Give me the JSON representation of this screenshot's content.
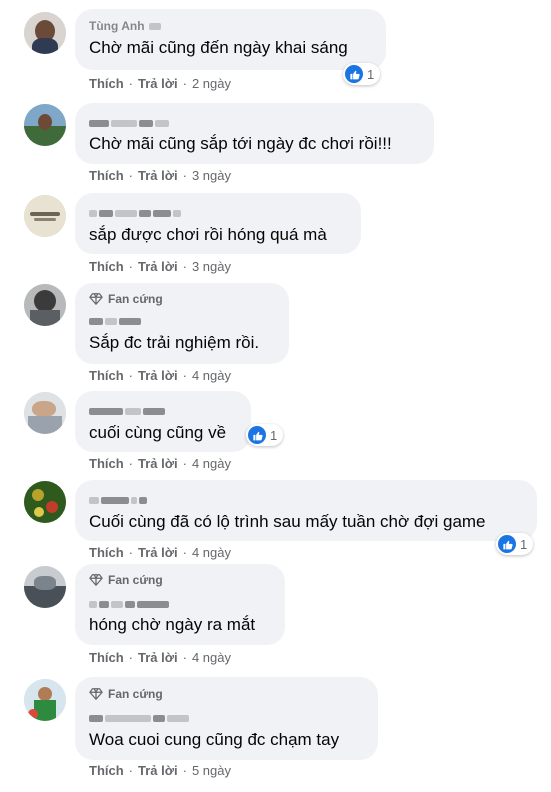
{
  "actions": {
    "like_label": "Thích",
    "reply_label": "Trả lời",
    "separator": "·"
  },
  "badge_label": "Fan cứng",
  "accent_color": "#1b74e4",
  "comments": [
    {
      "name": "Tùng Anh",
      "text": "Chờ mãi cũng đến ngày khai sáng",
      "time": "2 ngày",
      "reactions": "1"
    },
    {
      "name": "",
      "text": "Chờ mãi cũng sắp tới ngày đc chơi rồi!!!",
      "time": "3 ngày"
    },
    {
      "name": "",
      "text": "sắp được chơi rồi hóng quá mà",
      "time": "3 ngày"
    },
    {
      "name": "",
      "text": "Sắp đc trải nghiệm rồi.",
      "time": "4 ngày",
      "fan": true
    },
    {
      "name": "",
      "text": "cuối cùng cũng về",
      "time": "4 ngày",
      "reactions": "1"
    },
    {
      "name": "",
      "text": "Cuối cùng đã có lộ trình sau mấy tuần chờ đợi game",
      "time": "4 ngày",
      "reactions": "1"
    },
    {
      "name": "",
      "text": "hóng chờ ngày ra mắt",
      "time": "4 ngày",
      "fan": true
    },
    {
      "name": "",
      "text": "Woa cuoi cung cũng đc chạm tay",
      "time": "5 ngày",
      "fan": true
    }
  ]
}
